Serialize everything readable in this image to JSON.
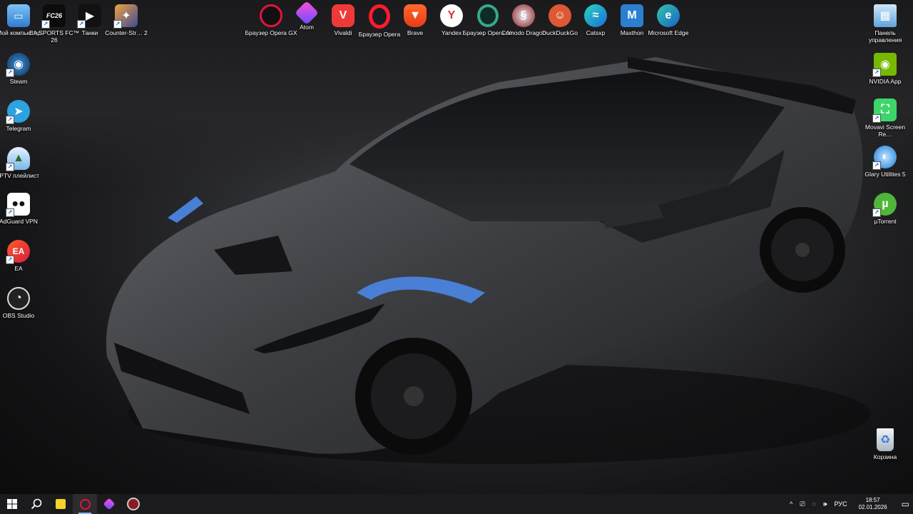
{
  "desktop": {
    "left_column": [
      {
        "label": "Мой компьютер",
        "icon": "computer-icon"
      },
      {
        "label": "Steam",
        "icon": "steam-icon"
      },
      {
        "label": "Telegram",
        "icon": "telegram-icon"
      },
      {
        "label": "IPTV плейлист",
        "icon": "iptv-icon"
      },
      {
        "label": "AdGuard VPN",
        "icon": "adguard-icon"
      },
      {
        "label": "EA",
        "icon": "ea-icon"
      },
      {
        "label": "OBS Studio",
        "icon": "obs-icon"
      }
    ],
    "top_left": [
      {
        "label": "EA SPORTS FC™ 26",
        "icon": "ea-fc-icon"
      },
      {
        "label": "Танки",
        "icon": "tanki-icon"
      },
      {
        "label": "Counter-Str… 2",
        "icon": "counter-strike-icon"
      }
    ],
    "top_browsers": [
      {
        "label": "Браузер Opera GX",
        "icon": "opera-gx-icon"
      },
      {
        "label": "Atom",
        "icon": "atom-icon"
      },
      {
        "label": "Vivaldi",
        "icon": "vivaldi-icon"
      },
      {
        "label": "Браузер Opera",
        "icon": "opera-icon"
      },
      {
        "label": "Brave",
        "icon": "brave-icon"
      },
      {
        "label": "Yandex",
        "icon": "yandex-icon"
      },
      {
        "label": "Браузер Opera Air",
        "icon": "opera-air-icon"
      },
      {
        "label": "Comodo Dragon",
        "icon": "comodo-dragon-icon"
      },
      {
        "label": "DuckDuckGo",
        "icon": "duckduckgo-icon"
      },
      {
        "label": "Catsxp",
        "icon": "catsxp-icon"
      },
      {
        "label": "Maxthon",
        "icon": "maxthon-icon"
      },
      {
        "label": "Microsoft Edge",
        "icon": "edge-icon"
      }
    ],
    "right_column": [
      {
        "label": "Панель управления",
        "icon": "control-panel-icon"
      },
      {
        "label": "NVIDIA App",
        "icon": "nvidia-icon"
      },
      {
        "label": "Movavi Screen Re…",
        "icon": "movavi-icon"
      },
      {
        "label": "Glary Utilities 5",
        "icon": "glary-icon"
      },
      {
        "label": "µTorrent",
        "icon": "utorrent-icon"
      }
    ],
    "recycle_bin": {
      "label": "Корзина",
      "icon": "recycle-bin-icon"
    }
  },
  "taskbar": {
    "pinned": [
      "start-icon",
      "search-icon",
      "sticky-notes-icon",
      "opera-gx-icon",
      "atom-icon",
      "comodo-dragon-icon"
    ],
    "tray": {
      "chevron": "^",
      "language": "РУС",
      "time": "18:57",
      "date": "02.01.2026"
    }
  }
}
